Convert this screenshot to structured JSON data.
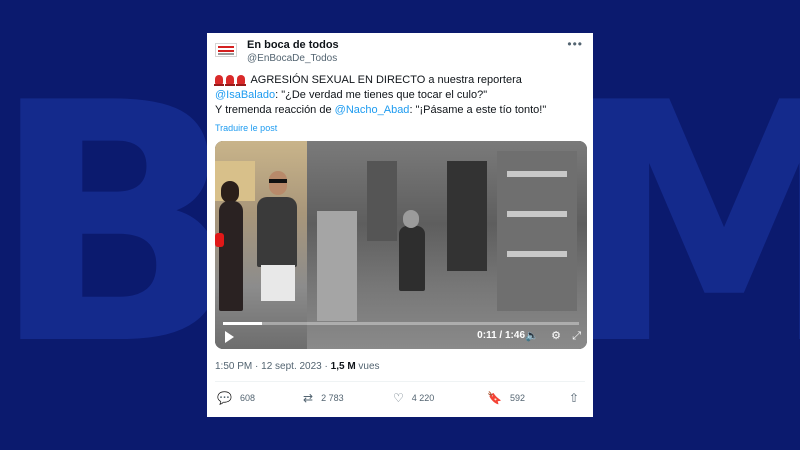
{
  "background": {
    "watermark": "BFM",
    "color": "#0b1a6e"
  },
  "tweet": {
    "display_name": "En boca de todos",
    "handle": "@EnBocaDe_Todos",
    "text_line1": "AGRESIÓN SEXUAL EN DIRECTO a nuestra reportera",
    "mention_reporter": "@IsaBalado",
    "quote1": ": \"¿De verdad me tienes que tocar el culo?\"",
    "text_line3_prefix": "Y tremenda reacción de ",
    "mention_presenter": "@Nacho_Abad",
    "quote2": ": \"¡Pásame a este tío tonto!\"",
    "translate_link": "Traduire le post",
    "more_icon": "more-horizontal-icon",
    "emoji_icon": "police-siren-icon"
  },
  "video": {
    "current_time": "0:11",
    "separator": " / ",
    "duration": "1:46",
    "progress_fraction": 0.11
  },
  "meta": {
    "time": "1:50 PM",
    "dot": " · ",
    "date": "12 sept. 2023",
    "dot2": " · ",
    "views_count": "1,5 M",
    "views_label": " vues"
  },
  "actions": {
    "replies": "608",
    "retweets": "2 783",
    "likes": "4 220",
    "bookmarks": "592"
  },
  "colors": {
    "link": "#1d9bf0",
    "text": "#0f1419",
    "secondary": "#536471"
  }
}
